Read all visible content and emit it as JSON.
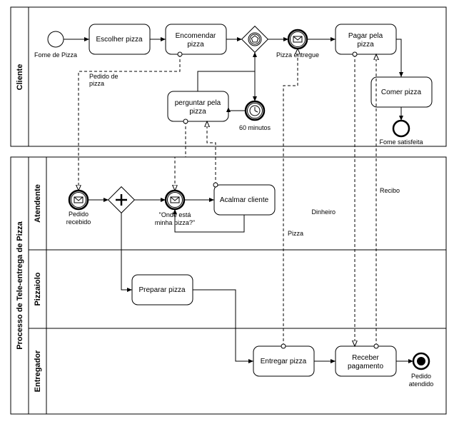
{
  "chart_data": {
    "type": "bpmn",
    "pools": [
      {
        "name": "Cliente",
        "lanes": [
          "Cliente"
        ]
      },
      {
        "name": "Processo de Tele-entrega de Pizza",
        "lanes": [
          "Atendente",
          "Pizzaiolo",
          "Entregador"
        ]
      }
    ],
    "nodes": [
      {
        "id": "start1",
        "type": "start",
        "lane": "Cliente",
        "label": "Fome de Pizza"
      },
      {
        "id": "t1",
        "type": "task",
        "lane": "Cliente",
        "label": "Escolher pizza"
      },
      {
        "id": "t2",
        "type": "task",
        "lane": "Cliente",
        "label": "Encomendar pizza"
      },
      {
        "id": "g1",
        "type": "event-gateway",
        "lane": "Cliente"
      },
      {
        "id": "e1",
        "type": "message-intermediate",
        "lane": "Cliente",
        "label": "Pizza entregue"
      },
      {
        "id": "e2",
        "type": "timer-intermediate",
        "lane": "Cliente",
        "label": "60 minutos"
      },
      {
        "id": "t3",
        "type": "task",
        "lane": "Cliente",
        "label": "perguntar pela pizza"
      },
      {
        "id": "t4",
        "type": "task",
        "lane": "Cliente",
        "label": "Pagar pela pizza"
      },
      {
        "id": "t5",
        "type": "task",
        "lane": "Cliente",
        "label": "Comer pizza"
      },
      {
        "id": "end1",
        "type": "end",
        "lane": "Cliente",
        "label": "Fome satisfeita"
      },
      {
        "id": "e3",
        "type": "message-start",
        "lane": "Atendente",
        "label": "Pedido recebido"
      },
      {
        "id": "g2",
        "type": "parallel-gateway",
        "lane": "Atendente"
      },
      {
        "id": "e4",
        "type": "message-intermediate",
        "lane": "Atendente",
        "label": "\"Onde está minha pizza?\""
      },
      {
        "id": "t6",
        "type": "task",
        "lane": "Atendente",
        "label": "Acalmar cliente"
      },
      {
        "id": "t7",
        "type": "task",
        "lane": "Pizzaiolo",
        "label": "Preparar pizza"
      },
      {
        "id": "t8",
        "type": "task",
        "lane": "Entregador",
        "label": "Entregar pizza"
      },
      {
        "id": "t9",
        "type": "task",
        "lane": "Entregador",
        "label": "Receber pagamento"
      },
      {
        "id": "end2",
        "type": "end-terminate",
        "lane": "Entregador",
        "label": "Pedido atendido"
      }
    ],
    "sequence_flows": [
      [
        "start1",
        "t1"
      ],
      [
        "t1",
        "t2"
      ],
      [
        "t2",
        "g1"
      ],
      [
        "g1",
        "e1"
      ],
      [
        "g1",
        "e2"
      ],
      [
        "e2",
        "t3"
      ],
      [
        "t3",
        "g1"
      ],
      [
        "e1",
        "t4"
      ],
      [
        "t4",
        "t5"
      ],
      [
        "t5",
        "end1"
      ],
      [
        "e3",
        "g2"
      ],
      [
        "g2",
        "e4"
      ],
      [
        "e4",
        "t6"
      ],
      [
        "t6",
        "e4"
      ],
      [
        "g2",
        "t7"
      ],
      [
        "t7",
        "t8"
      ],
      [
        "t8",
        "t9"
      ],
      [
        "t9",
        "end2"
      ]
    ],
    "message_flows": [
      {
        "from": "t2",
        "to": "e3",
        "label": "Pedido de pizza"
      },
      {
        "from": "t3",
        "to": "e4"
      },
      {
        "from": "t6",
        "to": "t3"
      },
      {
        "from": "t8",
        "to": "e1",
        "label": "Pizza"
      },
      {
        "from": "t4",
        "to": "t9",
        "label": "Dinheiro"
      },
      {
        "from": "t9",
        "to": "t4",
        "label": "Recibo"
      }
    ]
  },
  "pool1_label": "Cliente",
  "pool2_label": "Processo de Tele-entrega de Pizza",
  "lane_atendente": "Atendente",
  "lane_pizzaiolo": "Pizzaiolo",
  "lane_entregador": "Entregador",
  "start1": "Fome de Pizza",
  "t1": "Escolher pizza",
  "t2": "Encomendar",
  "t2b": "pizza",
  "e1": "Pizza entregue",
  "e2": "60 minutos",
  "t3a": "perguntar pela",
  "t3b": "pizza",
  "t4a": "Pagar pela",
  "t4b": "pizza",
  "t5": "Comer pizza",
  "end1": "Fome satisfeita",
  "e3a": "Pedido",
  "e3b": "recebido",
  "e4a": "\"Onde está",
  "e4b": "minha pizza?\"",
  "t6": "Acalmar cliente",
  "t7": "Preparar pizza",
  "t8": "Entregar pizza",
  "t9a": "Receber",
  "t9b": "pagamento",
  "end2a": "Pedido",
  "end2b": "atendido",
  "mf_pedido_a": "Pedido de",
  "mf_pedido_b": "pizza",
  "mf_pizza": "Pizza",
  "mf_dinheiro": "Dinheiro",
  "mf_recibo": "Recibo"
}
